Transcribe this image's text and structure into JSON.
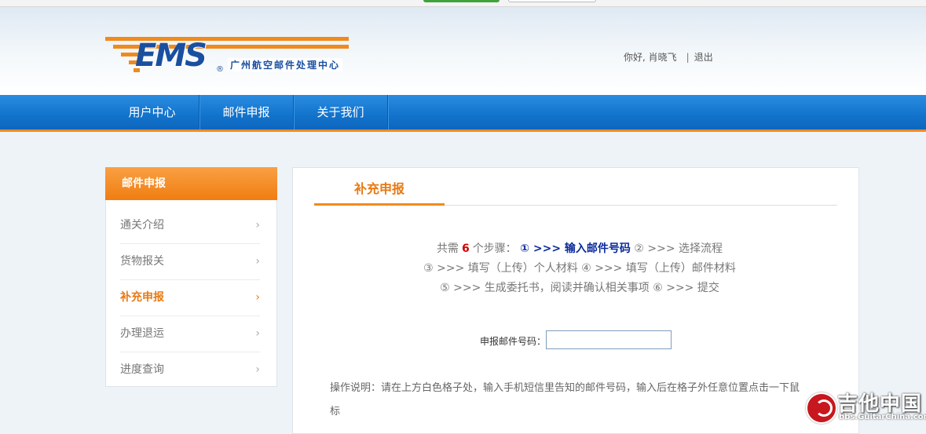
{
  "header": {
    "logo_text": "EMS",
    "logo_reg": "®",
    "center_name": "广州航空邮件处理中心",
    "greeting": "你好, 肖晓飞",
    "separator": "|",
    "logout": "退出"
  },
  "nav": {
    "items": [
      {
        "label": "用户中心"
      },
      {
        "label": "邮件申报"
      },
      {
        "label": "关于我们"
      }
    ]
  },
  "sidebar": {
    "title": "邮件申报",
    "items": [
      {
        "label": "通关介绍",
        "active": false
      },
      {
        "label": "货物报关",
        "active": false
      },
      {
        "label": "补充申报",
        "active": true
      },
      {
        "label": "办理退运",
        "active": false
      },
      {
        "label": "进度查询",
        "active": false
      }
    ],
    "chevron": "›"
  },
  "content": {
    "tab": "补充申报",
    "steps": {
      "prefix": "共需",
      "count": "6",
      "suffix": "个步骤：",
      "line1_current": "① >>> 输入邮件号码",
      "line1_rest": "② >>> 选择流程",
      "line2": "③ >>> 填写（上传）个人材料 ④ >>> 填写（上传）邮件材料",
      "line3": "⑤ >>> 生成委托书，阅读并确认相关事项 ⑥ >>> 提交"
    },
    "form": {
      "label": "申报邮件号码：",
      "value": ""
    },
    "note": "操作说明：请在上方白色格子处，输入手机短信里告知的邮件号码，输入后在格子外任意位置点击一下鼠标"
  },
  "watermark": {
    "cn": "吉他中国",
    "url": "bbs.GuitarChina.com"
  },
  "colors": {
    "nav_blue": "#1273cc",
    "accent_orange": "#f08a1c",
    "step_current": "#0b2b9c",
    "step_count": "#d40000"
  }
}
